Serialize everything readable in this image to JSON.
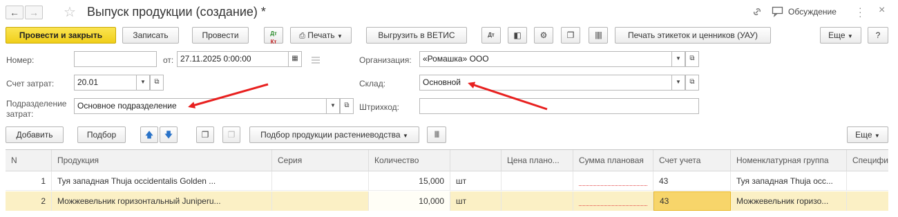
{
  "window": {
    "title": "Выпуск продукции (создание) *",
    "discussion_label": "Обсуждение"
  },
  "toolbar": {
    "post_close": "Провести и закрыть",
    "save": "Записать",
    "post": "Провести",
    "dt_kt_top": "Дт",
    "dt_kt_bottom": "Кт",
    "print": "Печать",
    "export_vetis": "Выгрузить в ВЕТИС",
    "print_labels": "Печать этикеток и ценников (УАУ)",
    "more": "Еще",
    "help": "?"
  },
  "form": {
    "number_label": "Номер:",
    "number_value": "",
    "from_label": "от:",
    "date_value": "27.11.2025  0:00:00",
    "org_label": "Организация:",
    "org_value": "«Ромашка» ООО",
    "cost_account_label": "Счет затрат:",
    "cost_account_value": "20.01",
    "warehouse_label": "Склад:",
    "warehouse_value": "Основной",
    "division_label_1": "Подразделение",
    "division_label_2": "затрат:",
    "division_value": "Основное подразделение",
    "barcode_label": "Штрихкод:",
    "barcode_value": ""
  },
  "table_toolbar": {
    "add": "Добавить",
    "select": "Подбор",
    "crop_select": "Подбор продукции растениеводства",
    "more": "Еще"
  },
  "table": {
    "columns": [
      "N",
      "Продукция",
      "Серия",
      "Количество",
      "",
      "Цена плано...",
      "Сумма плановая",
      "Счет учета",
      "Номенклатурная группа",
      "Специфи"
    ],
    "rows": [
      {
        "n": "1",
        "product": "Туя западная Thuja occidentalis Golden ...",
        "series": "",
        "qty": "15,000",
        "unit": "шт",
        "price": "",
        "sum": "",
        "account": "43",
        "group": "Туя западная Thuja occ...",
        "spec": ""
      },
      {
        "n": "2",
        "product": "Можжевельник горизонтальный Juniperu...",
        "series": "",
        "qty": "10,000",
        "unit": "шт",
        "price": "",
        "sum": "",
        "account": "43",
        "group": "Можжевельник горизо...",
        "spec": ""
      }
    ]
  },
  "colors": {
    "primary_button": "#f3d426",
    "selected_row": "#fbf0c5",
    "arrow": "#e8201f"
  }
}
